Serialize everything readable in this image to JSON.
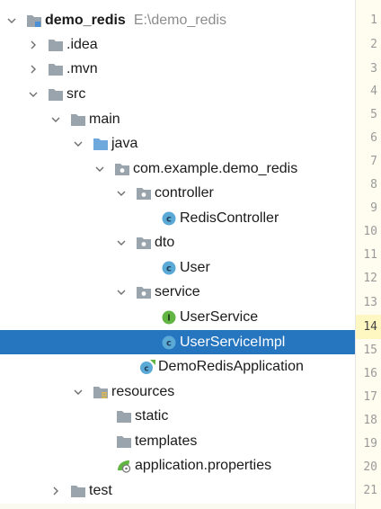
{
  "project": {
    "name": "demo_redis",
    "path": "E:\\demo_redis"
  },
  "tree": [
    {
      "label": "demo_redis",
      "bold": true,
      "path": "E:\\demo_redis",
      "expanded": true,
      "icon": "module-folder-icon"
    },
    {
      "label": ".idea",
      "expanded": false,
      "icon": "folder-icon"
    },
    {
      "label": ".mvn",
      "expanded": false,
      "icon": "folder-icon"
    },
    {
      "label": "src",
      "expanded": true,
      "icon": "folder-icon"
    },
    {
      "label": "main",
      "expanded": true,
      "icon": "folder-icon"
    },
    {
      "label": "java",
      "expanded": true,
      "icon": "source-root-folder-icon"
    },
    {
      "label": "com.example.demo_redis",
      "expanded": true,
      "icon": "package-icon"
    },
    {
      "label": "controller",
      "expanded": true,
      "icon": "package-icon"
    },
    {
      "label": "RedisController",
      "icon": "class-icon"
    },
    {
      "label": "dto",
      "expanded": true,
      "icon": "package-icon"
    },
    {
      "label": "User",
      "icon": "class-icon"
    },
    {
      "label": "service",
      "expanded": true,
      "icon": "package-icon"
    },
    {
      "label": "UserService",
      "icon": "interface-icon"
    },
    {
      "label": "UserServiceImpl",
      "icon": "class-icon",
      "selected": true
    },
    {
      "label": "DemoRedisApplication",
      "icon": "spring-boot-class-icon"
    },
    {
      "label": "resources",
      "expanded": true,
      "icon": "resources-root-folder-icon"
    },
    {
      "label": "static",
      "icon": "folder-icon"
    },
    {
      "label": "templates",
      "icon": "folder-icon"
    },
    {
      "label": "application.properties",
      "icon": "properties-file-icon"
    },
    {
      "label": "test",
      "expanded": false,
      "icon": "folder-icon"
    }
  ],
  "gutter": {
    "line_numbers": [
      "1",
      "2",
      "3",
      "4",
      "5",
      "6",
      "7",
      "8",
      "9",
      "10",
      "11",
      "12",
      "13",
      "14",
      "15",
      "16",
      "17",
      "18",
      "19",
      "20",
      "21"
    ],
    "current_line": "14"
  },
  "colors": {
    "selection": "#2675bf",
    "folder": "#9aa4ad",
    "source_root": "#6fa8dc",
    "class_icon": "#5aa9d6",
    "interface_icon": "#62b543",
    "gutter_bg": "#fffdf0"
  }
}
